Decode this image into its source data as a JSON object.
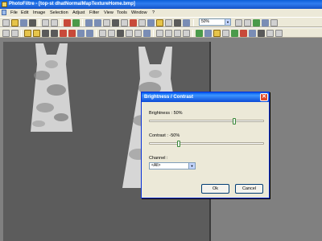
{
  "window": {
    "title": "PhotoFiltre - [top-st dhatNormalMapTextureHome.bmp]"
  },
  "menu": [
    "File",
    "Edit",
    "Image",
    "Selection",
    "Adjust",
    "Filter",
    "View",
    "Tools",
    "Window",
    "?"
  ],
  "toolbar": {
    "zoom_value": "50%",
    "dropdown_glyph": "▼"
  },
  "dialog": {
    "title": "Brightness / Contrast",
    "close_glyph": "✕",
    "brightness_label": "Brightness : 50%",
    "brightness_value": 50,
    "contrast_label": "Contrast : -50%",
    "contrast_value": -50,
    "channel_label": "Channel :",
    "channel_value": "<All>",
    "ok_label": "Ok",
    "cancel_label": "Cancel"
  },
  "colors": {
    "titlebar": "#0a5fd8",
    "dialog_title": "#0058ee",
    "workspace": "#808080",
    "canvas": "#5c5c5c",
    "dress_fabric": "#d4d4d4"
  }
}
